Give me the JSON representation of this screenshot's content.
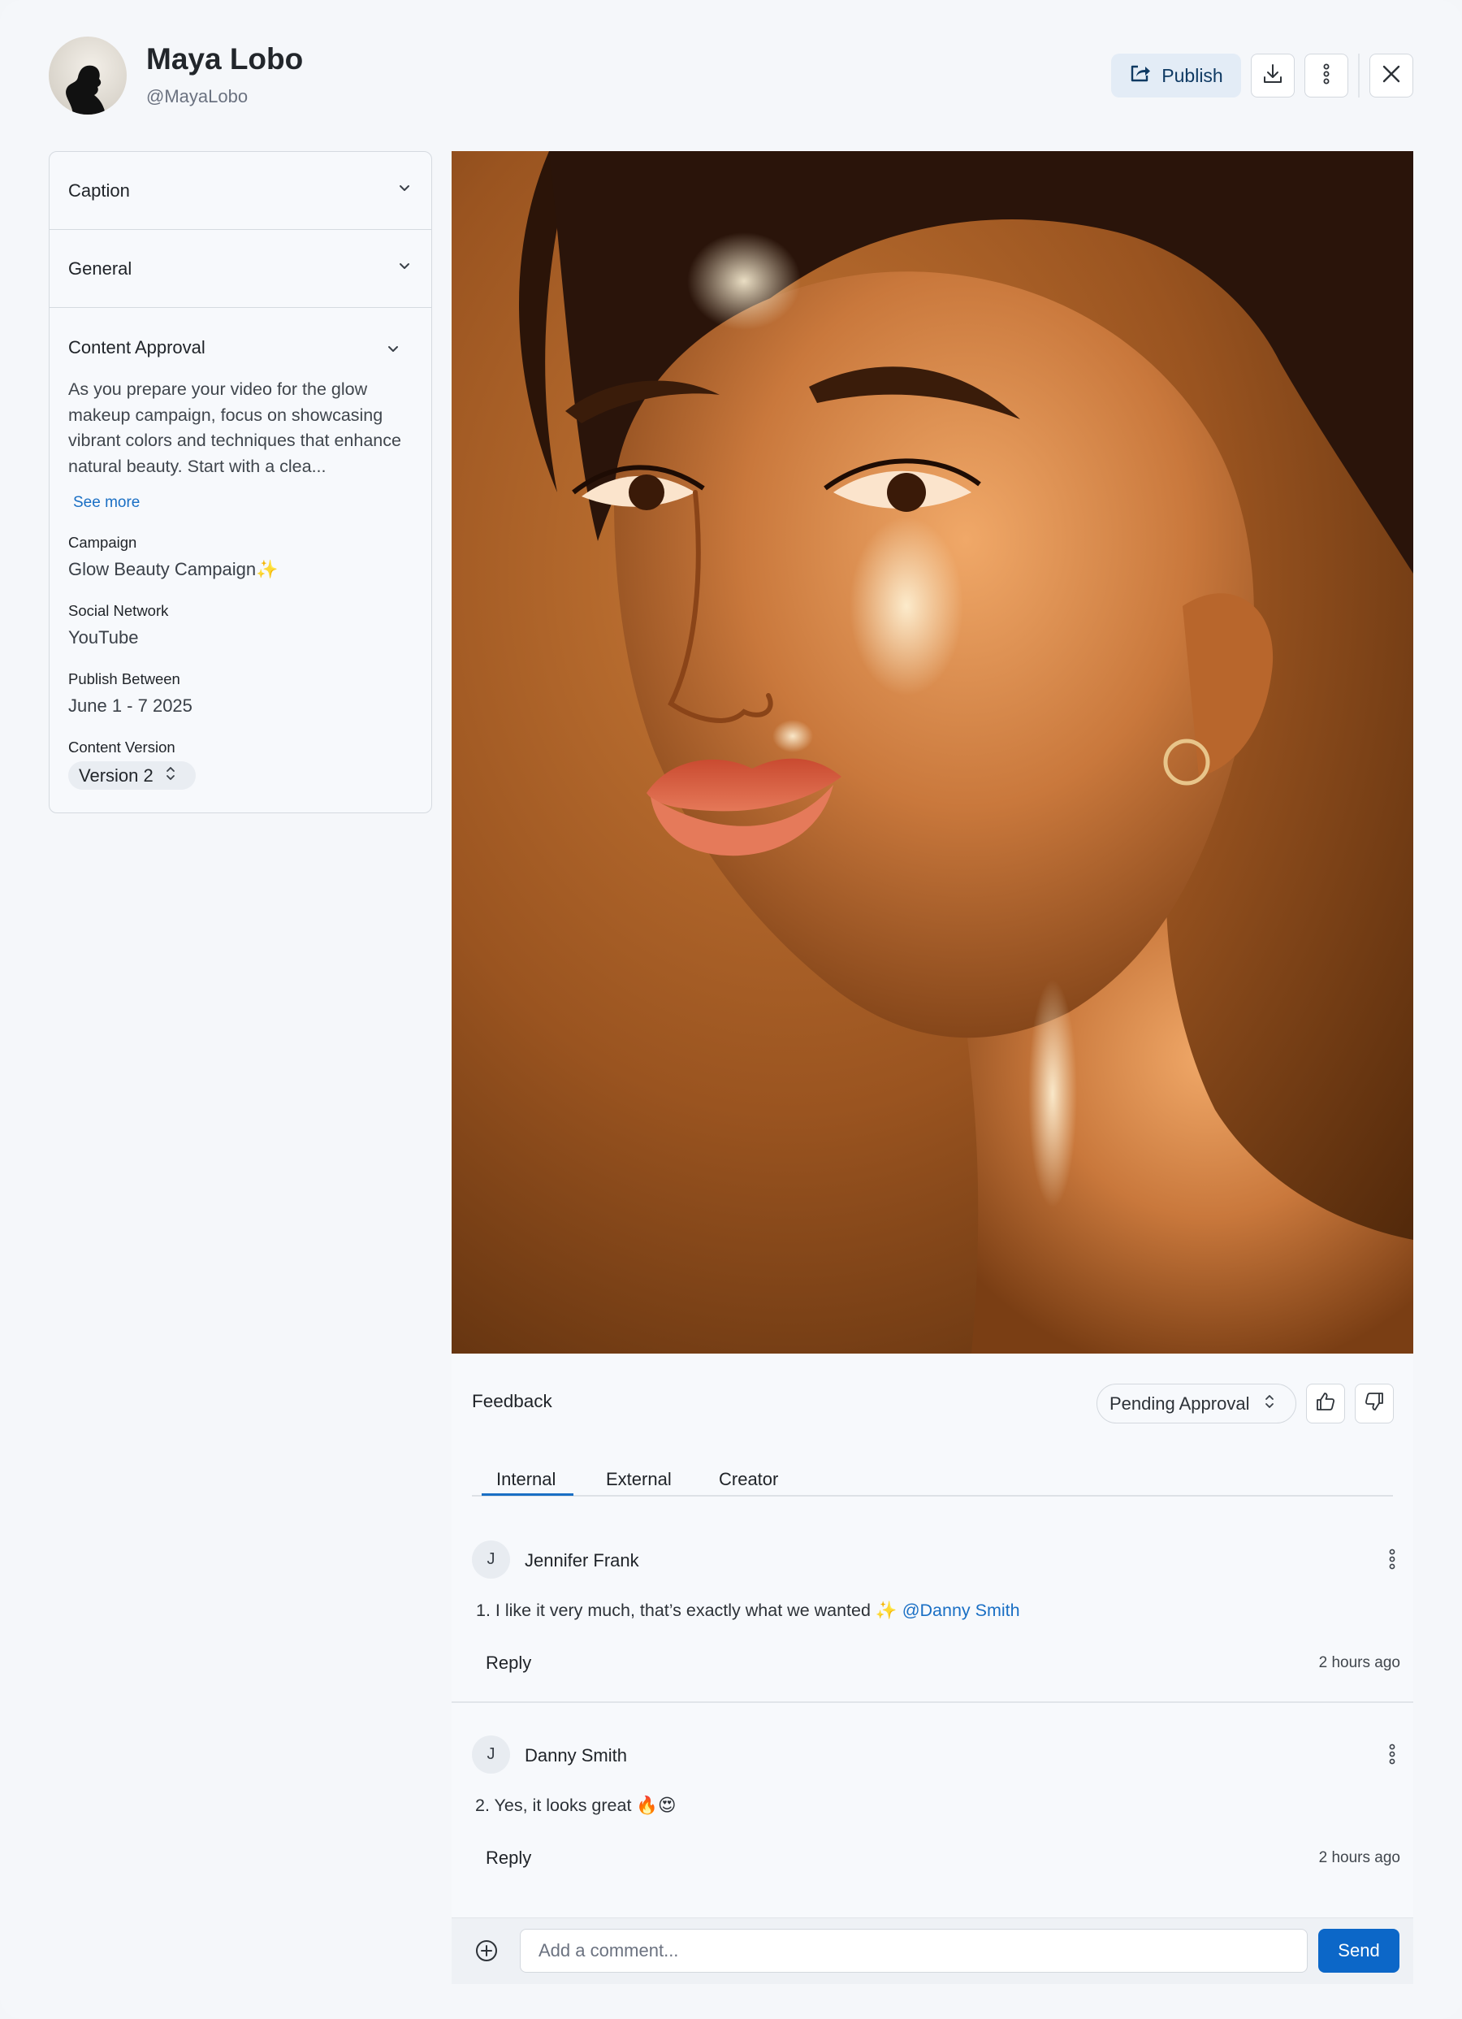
{
  "header": {
    "name": "Maya Lobo",
    "handle": "@MayaLobo",
    "publish_label": "Publish"
  },
  "sidebar": {
    "sections": [
      {
        "label": "Caption"
      },
      {
        "label": "General"
      },
      {
        "label": "Content Approval"
      }
    ],
    "description": "As you prepare your video for the glow makeup campaign, focus on showcasing vibrant colors and techniques that enhance natural beauty. Start with a clea...",
    "see_more": "See more",
    "fields": {
      "campaign_label": "Campaign",
      "campaign_value": "Glow Beauty Campaign✨",
      "network_label": "Social Network",
      "network_value": "YouTube",
      "publish_label": "Publish Between",
      "publish_value": "June 1 - 7 2025",
      "version_label": "Content Version",
      "version_value": "Version 2"
    }
  },
  "feedback": {
    "title": "Feedback",
    "status": "Pending Approval",
    "tabs": [
      {
        "label": "Internal",
        "active": true
      },
      {
        "label": "External",
        "active": false
      },
      {
        "label": "Creator",
        "active": false
      }
    ],
    "comments": [
      {
        "initial": "J",
        "author": "Jennifer Frank",
        "text": "1.  I like it very much, that’s exactly what we wanted ✨",
        "mention": "@Danny Smith",
        "reply": "Reply",
        "time": "2 hours ago"
      },
      {
        "initial": "J",
        "author": "Danny Smith",
        "text": "2. Yes, it looks great 🔥😍",
        "mention": "",
        "reply": "Reply",
        "time": "2 hours ago"
      }
    ]
  },
  "composer": {
    "placeholder": "Add a comment...",
    "send_label": "Send"
  },
  "colors": {
    "accent": "#0c67c8",
    "link": "#1a6fc4",
    "background": "#f5f7fa"
  }
}
